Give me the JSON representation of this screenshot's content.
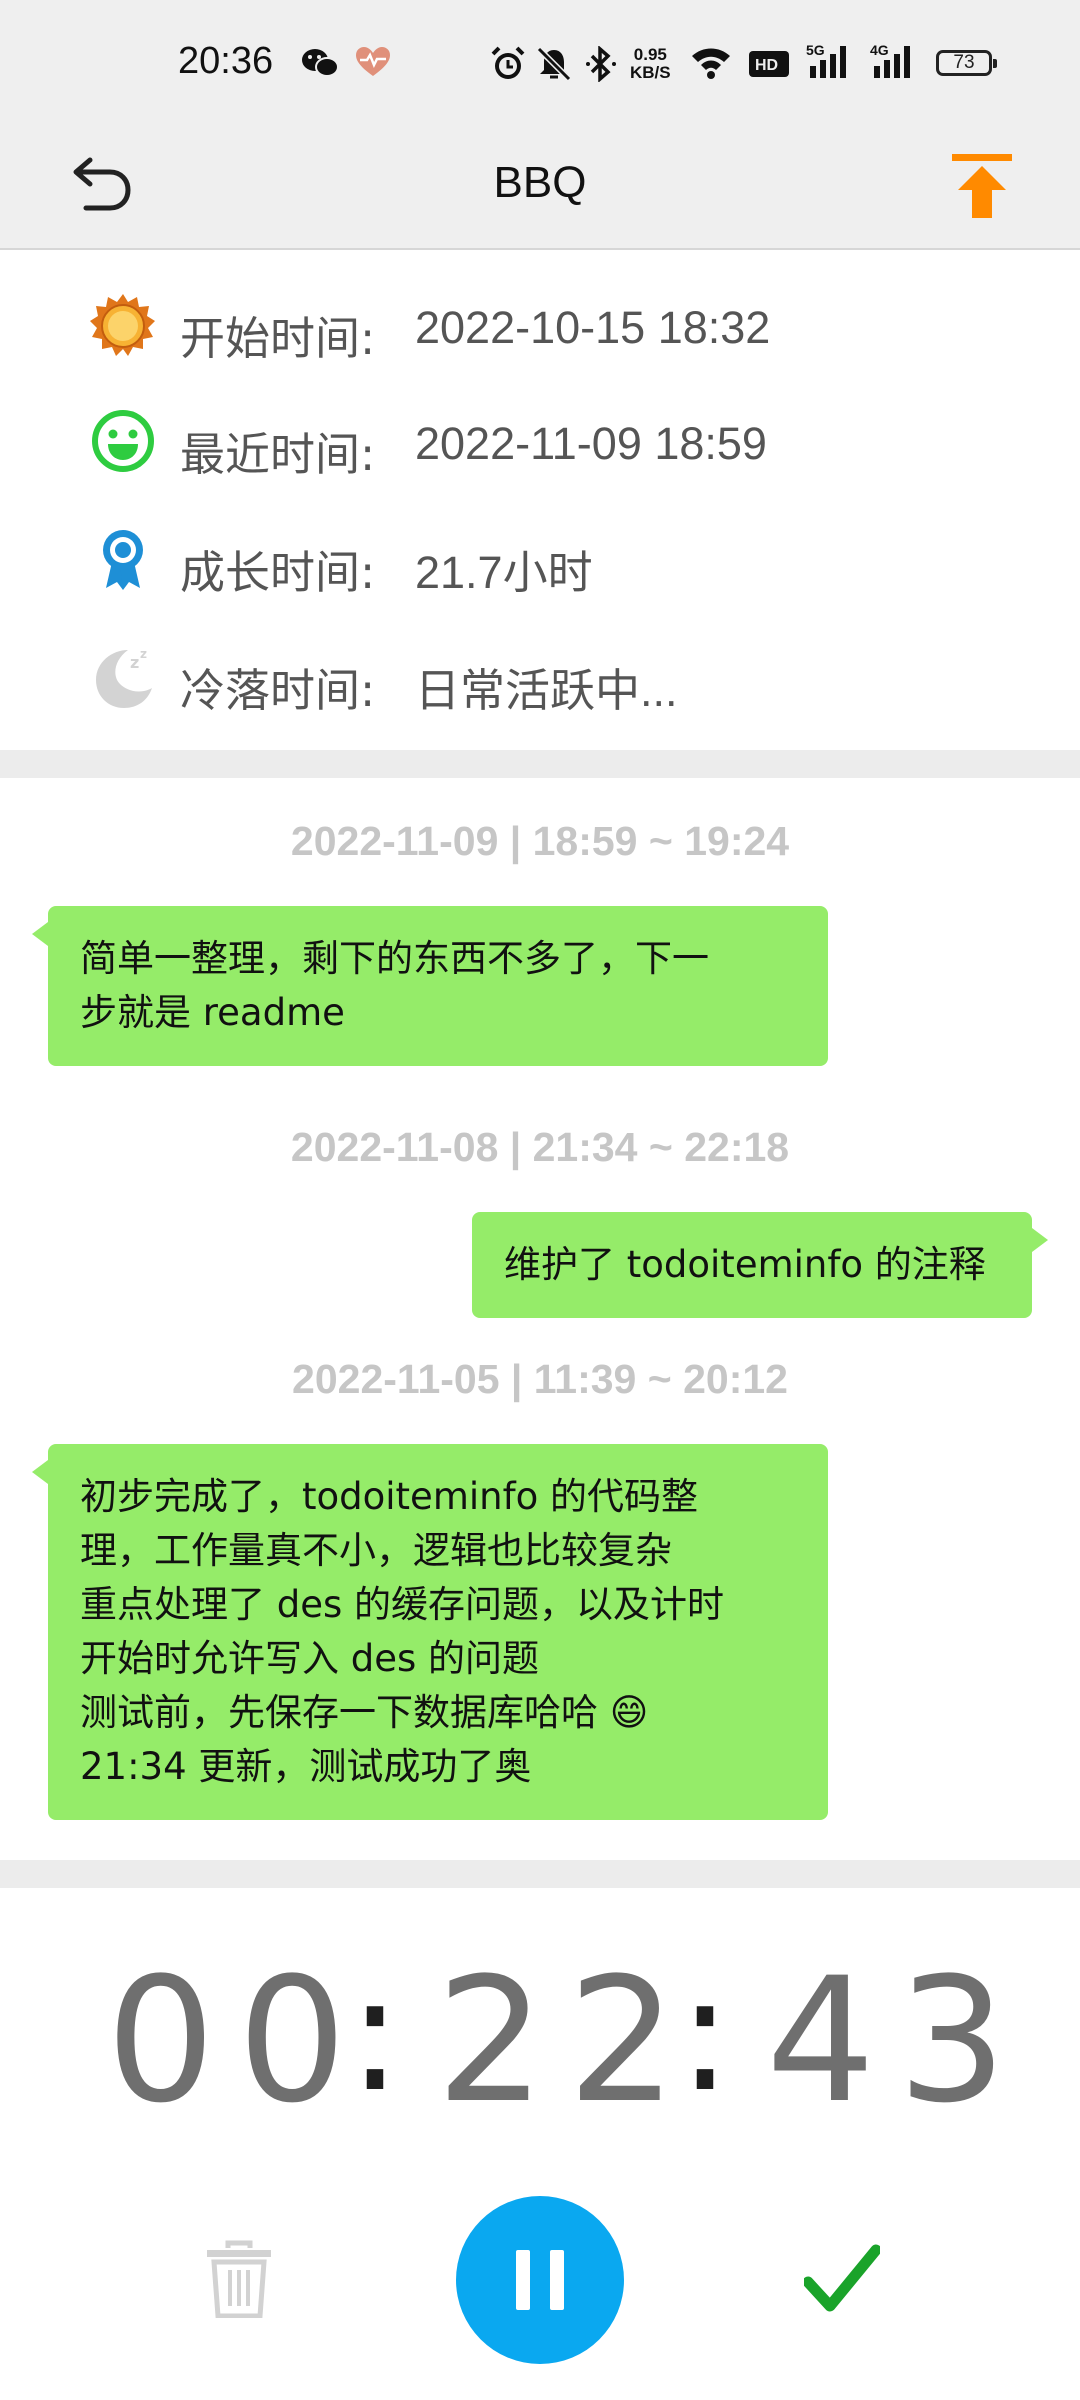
{
  "status_bar": {
    "time": "20:36",
    "net_speed_value": "0.95",
    "net_speed_unit": "KB/S",
    "hd_label": "HD",
    "net_5g": "5G",
    "net_4g": "4G",
    "battery": "73"
  },
  "header": {
    "title": "BBQ",
    "back_icon": "undo-arrow-icon",
    "upload_icon": "upload-to-top-icon",
    "accent_color": "#ff8a00"
  },
  "info": {
    "start": {
      "label": "开始时间:",
      "value": "2022-10-15 18:32",
      "icon": "sun-icon"
    },
    "recent": {
      "label": "最近时间:",
      "value": "2022-11-09 18:59",
      "icon": "smiley-icon"
    },
    "growth": {
      "label": "成长时间:",
      "value": "21.7小时",
      "icon": "award-badge-icon"
    },
    "idle": {
      "label": "冷落时间:",
      "value": "日常活跃中...",
      "icon": "moon-sleep-icon"
    }
  },
  "log": [
    {
      "stamp": "2022-11-09 | 18:59 ~ 19:24",
      "text": "简单一整理，剩下的东西不多了，下一\n步就是 readme"
    },
    {
      "stamp": "2022-11-08 | 21:34 ~ 22:18",
      "text": "维护了 todoiteminfo 的注释"
    },
    {
      "stamp": "2022-11-05 | 11:39 ~ 20:12",
      "text": "初步完成了，todoiteminfo 的代码整\n理，工作量真不小，逻辑也比较复杂\n重点处理了 des 的缓存问题，以及计时\n开始时允许写入 des 的问题\n测试前，先保存一下数据库哈哈 😄\n21:34 更新，测试成功了奥"
    }
  ],
  "timer": {
    "hours": "00",
    "minutes": "22",
    "seconds": "43"
  },
  "controls": {
    "delete_icon": "trash-icon",
    "pause_icon": "pause-icon",
    "confirm_icon": "checkmark-icon",
    "pause_color": "#0aa8f0",
    "confirm_color": "#1aa32a",
    "bubble_color": "#95ec69"
  }
}
